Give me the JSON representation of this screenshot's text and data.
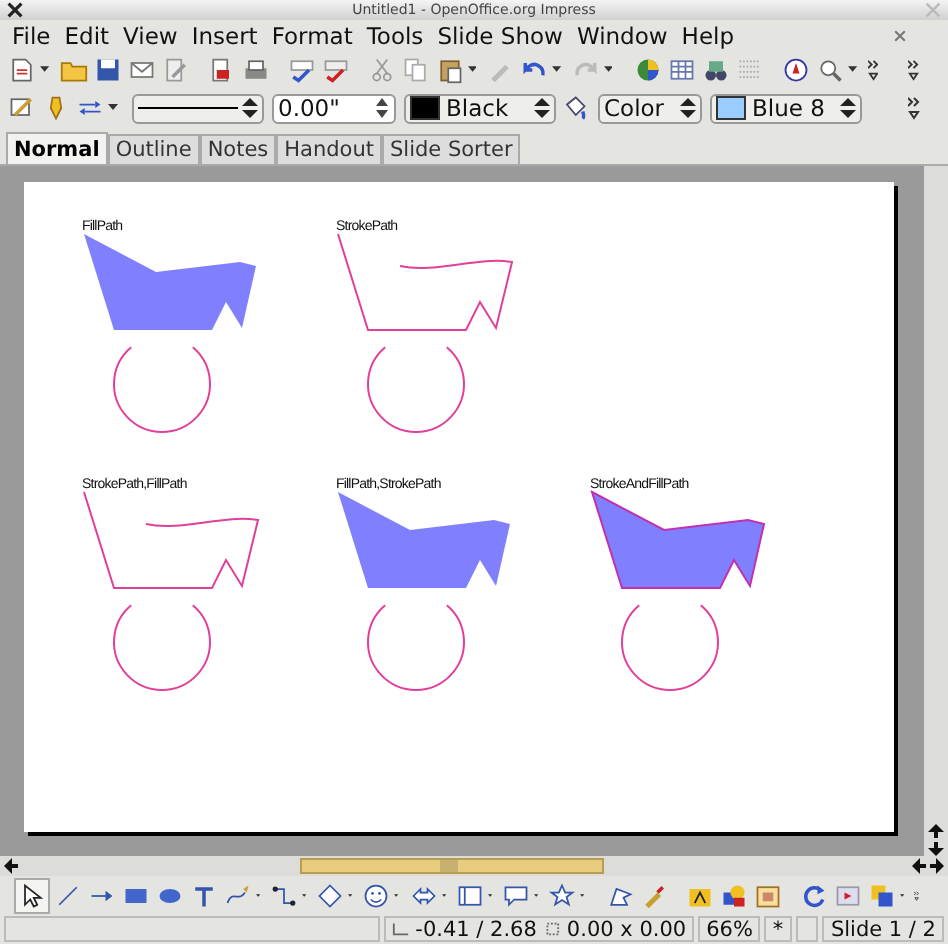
{
  "window": {
    "title": "Untitled1 - OpenOffice.org Impress"
  },
  "menu": [
    "File",
    "Edit",
    "View",
    "Insert",
    "Format",
    "Tools",
    "Slide Show",
    "Window",
    "Help"
  ],
  "format_bar": [
    {
      "kind": "line_style"
    },
    {
      "kind": "spin",
      "value": "0.00\""
    },
    {
      "kind": "line_color",
      "value": "Black",
      "color": "#000000"
    },
    {
      "kind": "fill_icon"
    },
    {
      "kind": "dropdown",
      "value": "Color"
    },
    {
      "kind": "area_color",
      "value": "Blue 8",
      "color": "#99ccff"
    }
  ],
  "view_tabs": [
    {
      "label": "Normal",
      "selected": true
    },
    {
      "label": "Outline",
      "selected": false
    },
    {
      "label": "Notes",
      "selected": false
    },
    {
      "label": "Handout",
      "selected": false
    },
    {
      "label": "Slide Sorter",
      "selected": false
    }
  ],
  "slide": {
    "panels": [
      {
        "label": "FillPath",
        "kind": "fill"
      },
      {
        "label": "StrokePath",
        "kind": "stroke"
      },
      {
        "label": "StrokePath,FillPath",
        "kind": "stroke"
      },
      {
        "label": "FillPath,StrokePath",
        "kind": "fill"
      },
      {
        "label": "StrokeAndFillPath",
        "kind": "both"
      }
    ]
  },
  "status_bar": {
    "position": "-0.41 / 2.68",
    "size": "0.00 x 0.00",
    "zoom": "66%",
    "modified": "*",
    "slide": "Slide 1 / 2"
  }
}
